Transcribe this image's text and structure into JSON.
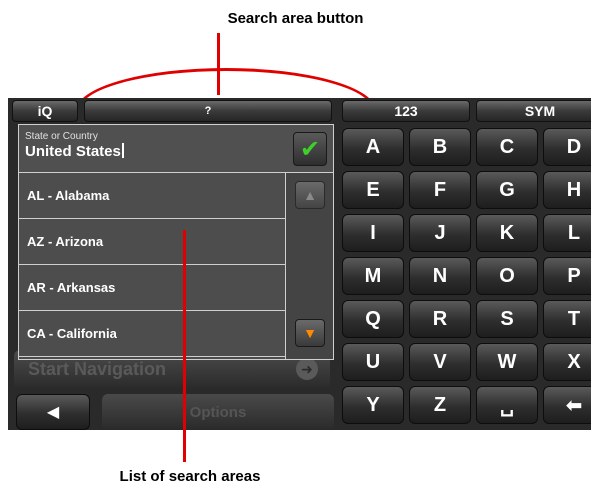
{
  "annotations": {
    "top_label": "Search area button",
    "bottom_label": "List of search areas",
    "accent_color": "#e00000"
  },
  "topbar": {
    "info_label": "iQ",
    "search_area_label": "?",
    "numeric_label": "123",
    "symbol_label": "SYM"
  },
  "field": {
    "label": "State or Country",
    "value": "United States",
    "confirm_icon": "checkmark-icon"
  },
  "list": {
    "items": [
      {
        "label": "AL - Alabama"
      },
      {
        "label": "AZ - Arizona"
      },
      {
        "label": "AR - Arkansas"
      },
      {
        "label": "CA - California"
      }
    ]
  },
  "scroll": {
    "up_icon": "triangle-up-icon",
    "down_icon": "triangle-down-icon",
    "down_color": "#ff8a00"
  },
  "background": {
    "start_navigation_label": "Start Navigation",
    "options_label": "Options",
    "back_icon": "triangle-left-icon"
  },
  "keyboard": {
    "rows": [
      [
        "A",
        "B",
        "C",
        "D"
      ],
      [
        "E",
        "F",
        "G",
        "H"
      ],
      [
        "I",
        "J",
        "K",
        "L"
      ],
      [
        "M",
        "N",
        "O",
        "P"
      ],
      [
        "Q",
        "R",
        "S",
        "T"
      ],
      [
        "U",
        "V",
        "W",
        "X"
      ],
      [
        "Y",
        "Z",
        "␣",
        "⬅"
      ]
    ]
  }
}
